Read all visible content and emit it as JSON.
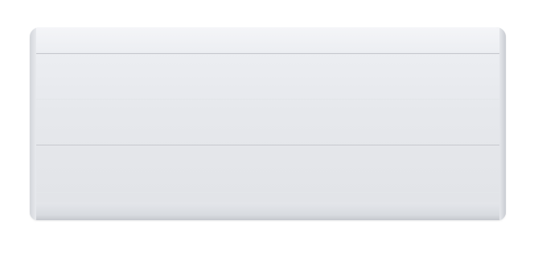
{
  "scene": {
    "subject": "radiator-panel",
    "colors": {
      "background": "#ffffff",
      "panel_face": "#e6e8ec",
      "seam_shadow": "#b6b9bf"
    }
  }
}
